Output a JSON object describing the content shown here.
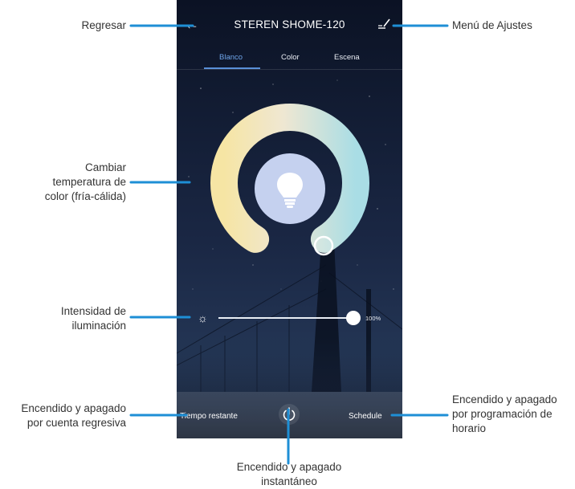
{
  "app": {
    "title": "STEREN SHOME-120",
    "tabs": [
      {
        "label": "Blanco",
        "active": true
      },
      {
        "label": "Color",
        "active": false
      },
      {
        "label": "Escena",
        "active": false
      }
    ],
    "brightness_value": "100%",
    "brightness_level": 1.0,
    "countdown_label": "Tiempo restante",
    "schedule_label": "Schedule",
    "accent_color": "#5a90d8",
    "icons": [
      "back-arrow-icon",
      "edit-settings-icon",
      "light-bulb-icon",
      "sun-icon",
      "power-icon"
    ]
  },
  "annotations": {
    "back": "Regresar",
    "settings_menu": "Menú de Ajustes",
    "color_temperature": [
      "Cambiar",
      "temperatura de",
      "color (fría-cálida)"
    ],
    "brightness": [
      "Intensidad de",
      "iluminación"
    ],
    "countdown": [
      "Encendido y apagado",
      "por cuenta regresiva"
    ],
    "schedule": [
      "Encendido y apagado",
      "por programación de",
      "horario"
    ],
    "instant": [
      "Encendido y apagado",
      "instantáneo"
    ]
  }
}
